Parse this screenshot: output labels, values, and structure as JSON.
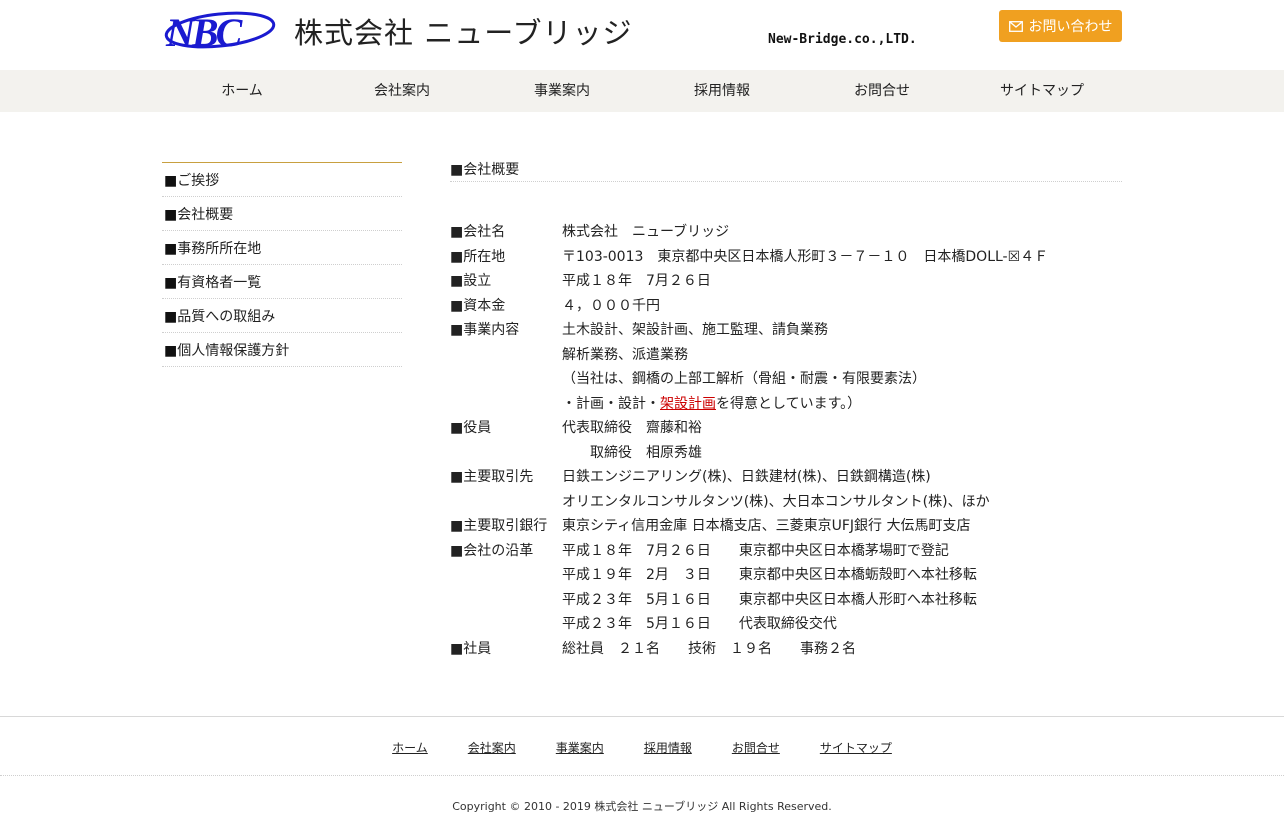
{
  "header": {
    "logo_text": "NBC",
    "company_name": "株式会社 ニューブリッジ",
    "company_en": "New-Bridge.co.,LTD.",
    "contact_label": "お問い合わせ",
    "brand_blue": "#1a1ad0",
    "accent_orange": "#f0a020"
  },
  "nav": {
    "items": [
      "ホーム",
      "会社案内",
      "事業案内",
      "採用情報",
      "お問合せ",
      "サイトマップ"
    ]
  },
  "sidebar": {
    "marker": "■",
    "items": [
      "ご挨拶",
      "会社概要",
      "事務所所在地",
      "有資格者一覧",
      "品質への取組み",
      "個人情報保護方針"
    ]
  },
  "main": {
    "title": "■会社概要",
    "company_label": "■会社名",
    "company_value": "株式会社　ニューブリッジ",
    "address_label": "■所在地",
    "address_value": "〒103-0013　東京都中央区日本橋人形町３－７－１０　日本橋DOLL-☒４Ｆ",
    "founded_label": "■設立",
    "founded_value": "平成１８年　7月２６日",
    "capital_label": "■資本金",
    "capital_value": "４，０００千円",
    "business_label": "■事業内容",
    "business_line1": "土木設計、架設計画、施工監理、請負業務",
    "business_line2": "解析業務、派遣業務",
    "business_line3": "（当社は、鋼橋の上部工解析（骨組・耐震・有限要素法）",
    "business_line4_pre": "・計画・設計・",
    "business_line4_link": "架設計画",
    "business_line4_post": "を得意としています。）",
    "officers_label": "■役員",
    "officer1": "代表取締役　齋藤和裕",
    "officer2": "　　取締役　相原秀雄",
    "clients_label": "■主要取引先",
    "clients_line1": "日鉄エンジニアリング(株)、日鉄建材(株)、日鉄鋼構造(株)",
    "clients_line2": "オリエンタルコンサルタンツ(株)、大日本コンサルタント(株)、ほか",
    "banks_label": "■主要取引銀行",
    "banks_value": "東京シティ信用金庫 日本橋支店、三菱東京UFJ銀行 大伝馬町支店",
    "history_label": "■会社の沿革",
    "history": [
      "平成１８年　7月２６日　　東京都中央区日本橋茅場町で登記",
      "平成１９年　2月　３日　　東京都中央区日本橋蛎殻町へ本社移転",
      "平成２３年　5月１６日　　東京都中央区日本橋人形町へ本社移転",
      "平成２３年　5月１６日　　代表取締役交代"
    ],
    "staff_label": "■社員",
    "staff_value": "総社員　２１名　　技術　１９名　　事務２名"
  },
  "footer": {
    "nav": [
      "ホーム",
      "会社案内",
      "事業案内",
      "採用情報",
      "お問合せ",
      "サイトマップ"
    ],
    "copyright": "Copyright © 2010 - 2019 株式会社 ニューブリッジ All Rights Reserved."
  }
}
